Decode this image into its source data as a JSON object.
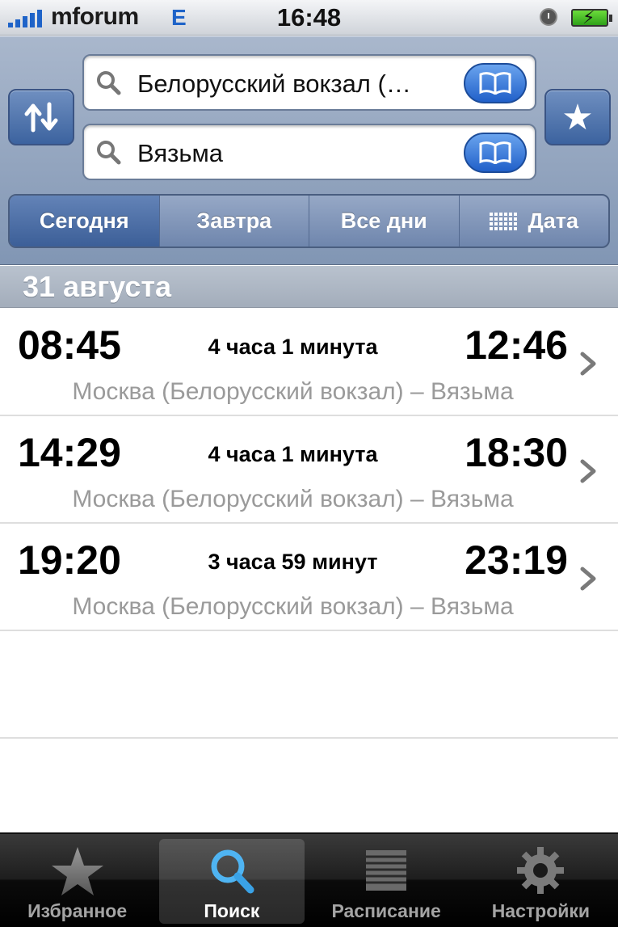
{
  "status_bar": {
    "carrier": "mforum",
    "network": "E",
    "time": "16:48"
  },
  "search": {
    "from": {
      "value": "Белорусский вокзал (…"
    },
    "to": {
      "value": "Вязьма"
    }
  },
  "segmented": {
    "today": "Сегодня",
    "tomorrow": "Завтра",
    "all_days": "Все дни",
    "date": "Дата",
    "selected": "today"
  },
  "section": {
    "date_header": "31 августа"
  },
  "trips": [
    {
      "departure": "08:45",
      "duration": "4 часа 1 минута",
      "arrival": "12:46",
      "route": "Москва (Белорусский вокзал) – Вязьма"
    },
    {
      "departure": "14:29",
      "duration": "4 часа 1 минута",
      "arrival": "18:30",
      "route": "Москва (Белорусский вокзал) – Вязьма"
    },
    {
      "departure": "19:20",
      "duration": "3 часа 59 минут",
      "arrival": "23:19",
      "route": "Москва (Белорусский вокзал) – Вязьма"
    }
  ],
  "tabbar": {
    "favorites": "Избранное",
    "search": "Поиск",
    "schedule": "Расписание",
    "settings": "Настройки",
    "active": "search"
  },
  "colors": {
    "header_bg": "#8fa2bf",
    "button_blue": "#4a6da8",
    "route_gray": "#9a9a9a",
    "tabbar_bg": "#1a1a1a"
  }
}
